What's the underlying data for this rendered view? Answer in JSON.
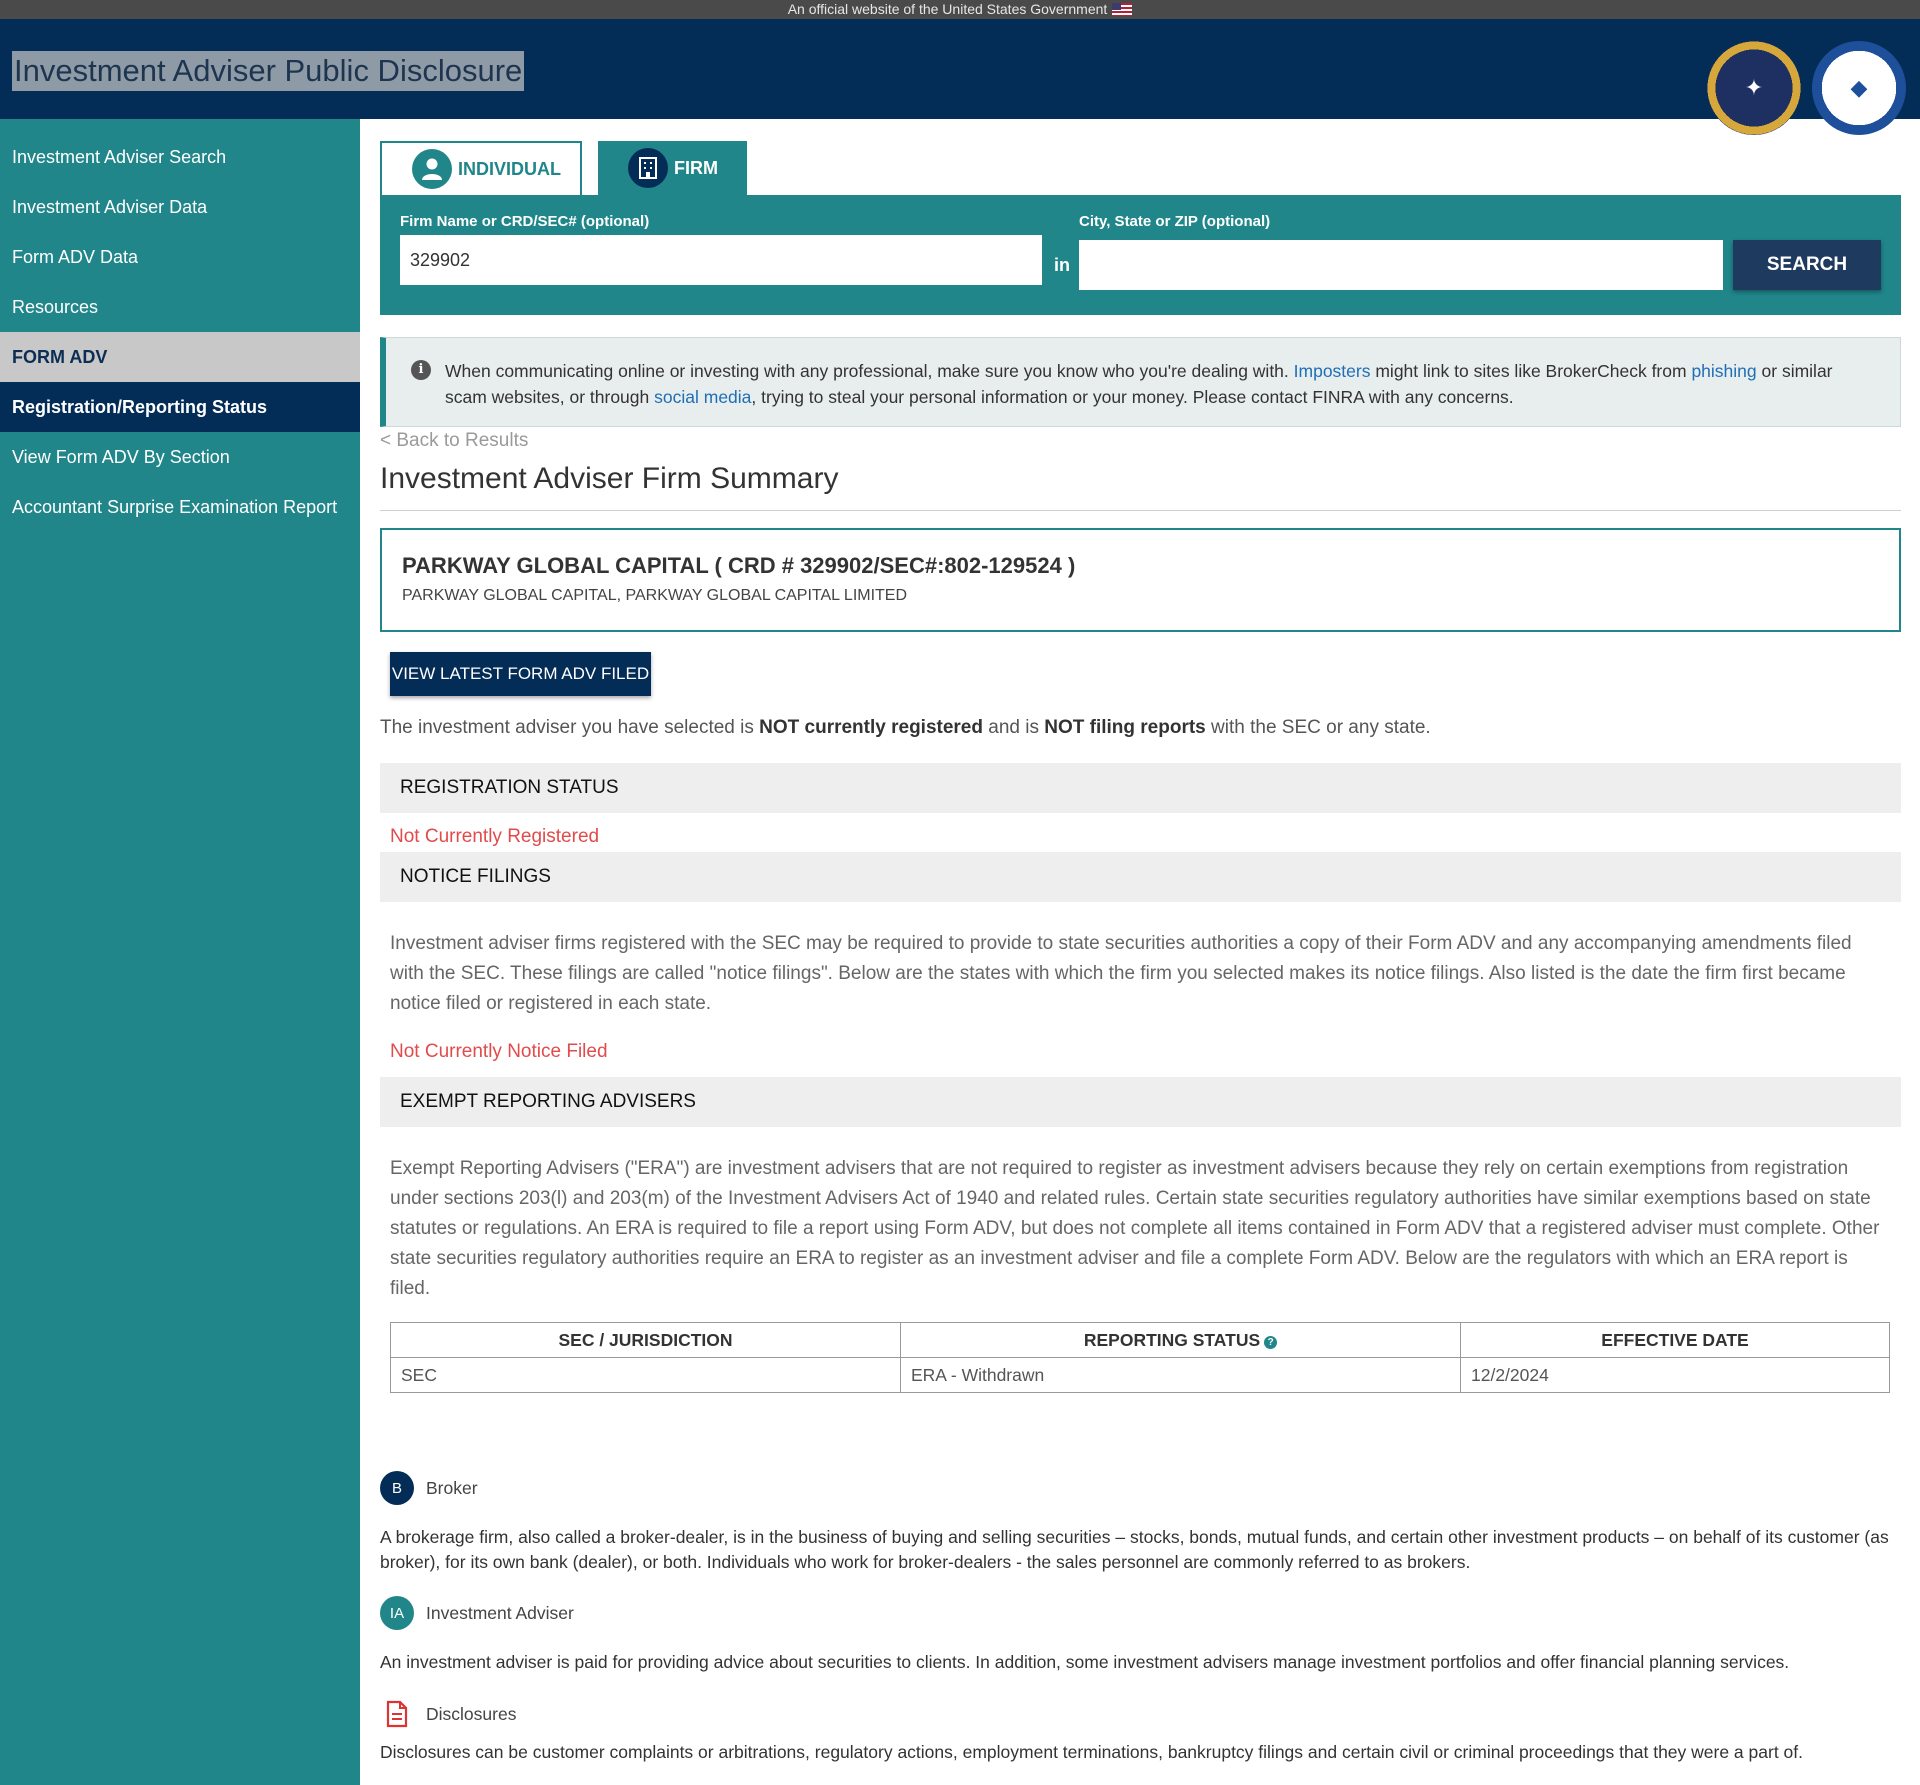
{
  "gov_banner": "An official website of the United States Government",
  "header": {
    "title": "Investment Adviser Public Disclosure"
  },
  "sidebar": {
    "items": [
      {
        "label": "Investment Adviser Search"
      },
      {
        "label": "Investment Adviser Data"
      },
      {
        "label": "Form ADV Data"
      },
      {
        "label": "Resources"
      },
      {
        "label": "FORM ADV"
      },
      {
        "label": "Registration/Reporting Status"
      },
      {
        "label": "View Form ADV By Section"
      },
      {
        "label": "Accountant Surprise Examination Report"
      }
    ]
  },
  "tabs": {
    "individual": "INDIVIDUAL",
    "firm": "FIRM"
  },
  "search": {
    "name_label": "Firm Name or CRD/SEC# (optional)",
    "name_value": "329902",
    "in_label": "in",
    "location_label": "City, State or ZIP (optional)",
    "location_value": "",
    "button": "SEARCH"
  },
  "alert": {
    "p1": "When communicating online or investing with any professional, make sure you know who you're dealing with.",
    "link1": "Imposters",
    "p2": "might link to sites like BrokerCheck from",
    "link2": "phishing",
    "p3": "or similar scam websites, or through",
    "link3": "social media",
    "p4": ", trying to steal your personal information or your money. Please contact FINRA with any concerns."
  },
  "back_link": "< Back to Results",
  "page_title": "Investment Adviser Firm Summary",
  "firm": {
    "name": "PARKWAY GLOBAL CAPITAL ( CRD # 329902/SEC#:802-129524 )",
    "aliases": "PARKWAY GLOBAL CAPITAL, PARKWAY GLOBAL CAPITAL LIMITED"
  },
  "adv_button": "VIEW LATEST FORM ADV FILED",
  "status_line": {
    "a": "The investment adviser you have selected is",
    "b": "NOT currently registered",
    "c": "and is",
    "d": "NOT filing reports",
    "e": "with the SEC or any state."
  },
  "registration": {
    "heading": "REGISTRATION STATUS",
    "value": "Not Currently Registered"
  },
  "notice": {
    "heading": "NOTICE FILINGS",
    "text": "Investment adviser firms registered with the SEC may be required to provide to state securities authorities a copy of their Form ADV and any accompanying amendments filed with the SEC. These filings are called \"notice filings\". Below are the states with which the firm you selected makes its notice filings. Also listed is the date the firm first became notice filed or registered in each state.",
    "value": "Not Currently Notice Filed"
  },
  "era": {
    "heading": "EXEMPT REPORTING ADVISERS",
    "text": "Exempt Reporting Advisers (\"ERA\") are investment advisers that are not required to register as investment advisers because they rely on certain exemptions from registration under sections 203(l) and 203(m) of the Investment Advisers Act of 1940 and related rules. Certain state securities regulatory authorities have similar exemptions based on state statutes or regulations. An ERA is required to file a report using Form ADV, but does not complete all items contained in Form ADV that a registered adviser must complete. Other state securities regulatory authorities require an ERA to register as an investment adviser and file a complete Form ADV. Below are the regulators with which an ERA report is filed.",
    "columns": [
      "SEC / JURISDICTION",
      "REPORTING STATUS",
      "EFFECTIVE DATE"
    ],
    "rows": [
      {
        "jurisdiction": "SEC",
        "status": "ERA - Withdrawn",
        "date": "12/2/2024"
      }
    ]
  },
  "legend": {
    "broker": {
      "badge": "B",
      "title": "Broker",
      "desc": "A brokerage firm, also called a broker-dealer, is in the business of buying and selling securities – stocks, bonds, mutual funds, and certain other investment products – on behalf of its customer (as broker), for its own bank (dealer), or both. Individuals who work for broker-dealers - the sales personnel are commonly referred to as brokers."
    },
    "adviser": {
      "badge": "IA",
      "title": "Investment Adviser",
      "desc": "An investment adviser is paid for providing advice about securities to clients. In addition, some investment advisers manage investment portfolios and offer financial planning services."
    },
    "disclosures": {
      "title": "Disclosures",
      "desc": "Disclosures can be customer complaints or arbitrations, regulatory actions, employment terminations, bankruptcy filings and certain civil or criminal proceedings that they were a part of."
    }
  },
  "icons": {
    "flag": "us-flag-icon",
    "seal_sec": "sec-seal-logo",
    "seal_nasaa": "state-regulators-seal-logo",
    "individual": "person-icon",
    "firm": "building-icon",
    "info": "info-icon",
    "help": "help-icon",
    "document": "document-icon"
  },
  "colors": {
    "navy": "#032d57",
    "teal": "#20868a",
    "alert_red": "#e24b4b",
    "link_blue": "#1f6fb5"
  }
}
